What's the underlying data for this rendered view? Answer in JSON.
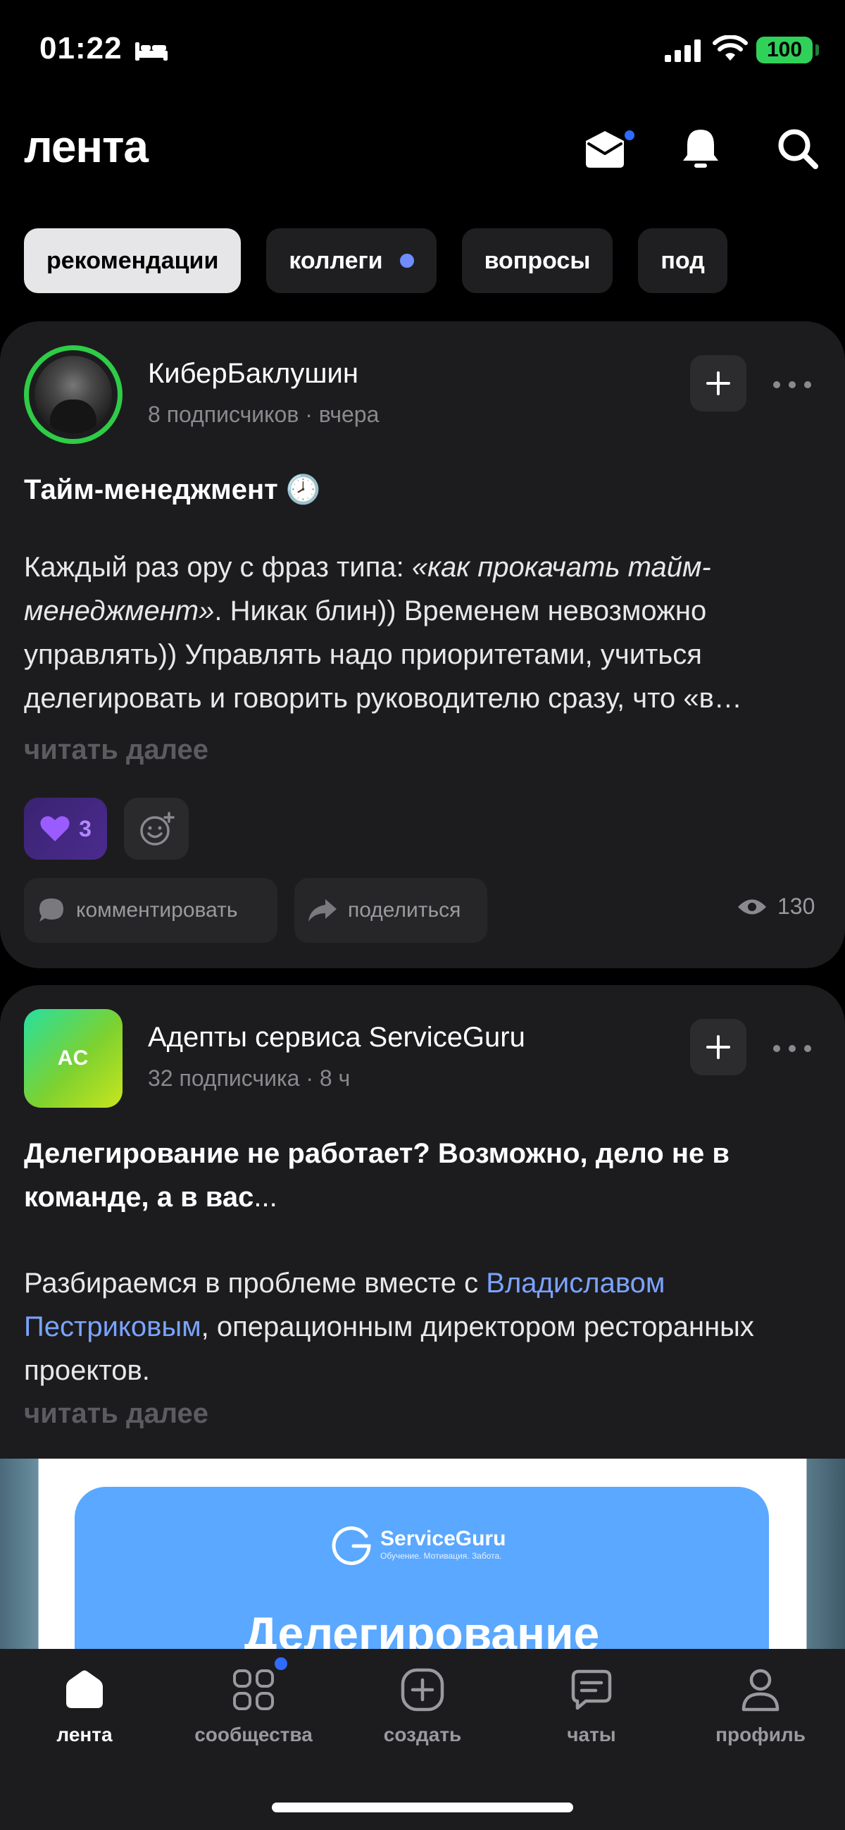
{
  "status_bar": {
    "time": "01:22",
    "battery": "100"
  },
  "header": {
    "logo": "лента"
  },
  "tabs": [
    {
      "label": "рекомендации",
      "active": true
    },
    {
      "label": "коллеги",
      "has_dot": true
    },
    {
      "label": "вопросы"
    },
    {
      "label": "под"
    }
  ],
  "posts": [
    {
      "author": "КиберБаклушин",
      "meta": "8 подписчиков · вчера",
      "title": "Тайм-менеджмент 🕗",
      "body_line1_pre": "Каждый раз ору с фраз типа: ",
      "body_italic": "«как прокачать тайм-менеджмент»",
      "body_rest": ". Никак блин)) Временем невозможно управлять)) Управлять надо приоритетами, учиться делегировать и говорить руководителю сразу, что «в…",
      "read_more": "читать далее",
      "reaction_count": "3",
      "comment_label": "комментировать",
      "share_label": "поделиться",
      "views": "130"
    },
    {
      "author": "Адепты сервиса ServiceGuru",
      "avatar_initials": "АС",
      "meta": "32 подписчика · 8 ч",
      "title": "Делегирование не работает? Возможно, дело не в команде, а в вас",
      "title_ellipsis": "...",
      "body_pre": "Разбираемся в проблеме вместе с ",
      "body_link": "Владиславом Пестриковым",
      "body_post": ", операционным директором ресторанных проектов.",
      "read_more": "читать далее",
      "preview": {
        "logo_text": "ServiceGuru",
        "logo_sub": "Обучение. Мотивация. Забота.",
        "heading": "Делегирование"
      }
    }
  ],
  "bottom_nav": [
    {
      "label": "лента",
      "icon": "home-icon",
      "active": true
    },
    {
      "label": "сообщества",
      "icon": "grid-icon",
      "has_dot": true
    },
    {
      "label": "создать",
      "icon": "plus-square-icon"
    },
    {
      "label": "чаты",
      "icon": "chat-icon"
    },
    {
      "label": "профиль",
      "icon": "person-icon"
    }
  ],
  "colors": {
    "accent": "#2f6bff",
    "online_ring": "#2fcc47",
    "link": "#7ba3ff",
    "battery": "#30d158"
  }
}
